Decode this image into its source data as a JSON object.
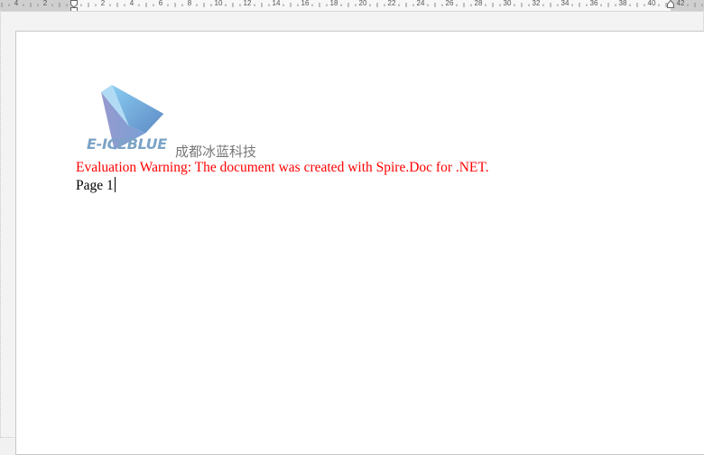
{
  "ruler": {
    "labels": [
      "4",
      "2",
      "2",
      "4",
      "6",
      "8",
      "10",
      "12",
      "14",
      "16",
      "18",
      "20",
      "22",
      "24",
      "26",
      "28",
      "30",
      "32",
      "34",
      "36",
      "38",
      "40",
      "42"
    ]
  },
  "document": {
    "logo_text": "E-ICEBLUE",
    "company_name": "成都冰蓝科技",
    "warning_text": "Evaluation Warning: The document was created with Spire.Doc for .NET.",
    "page_text": "Page 1"
  },
  "colors": {
    "warning": "#ff0000",
    "logo_text": "#7ba3c6",
    "logo_shape": "#6fa6e0"
  }
}
